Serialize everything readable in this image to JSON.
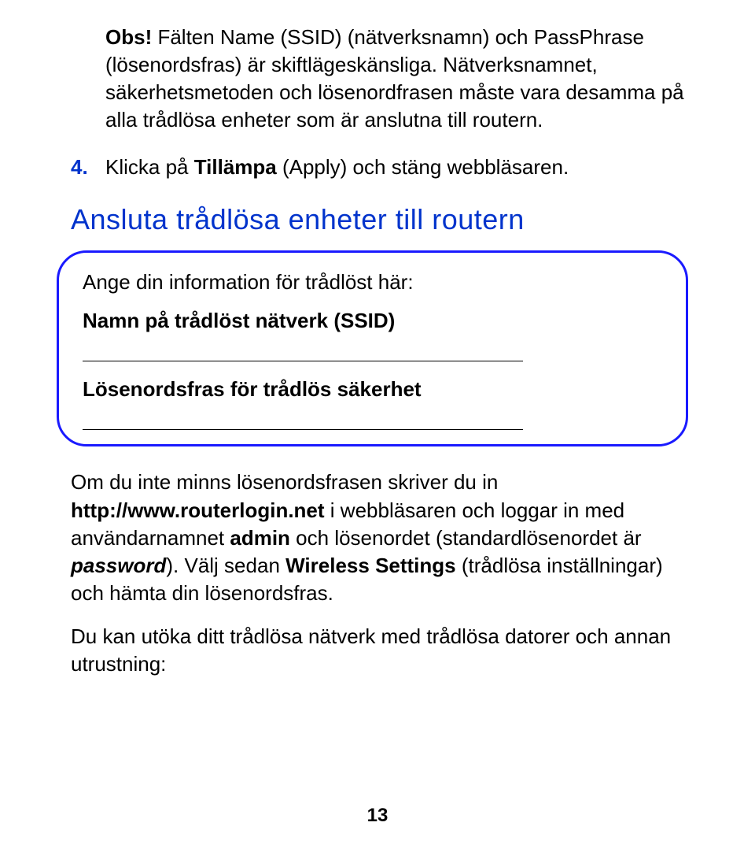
{
  "para1_obs": "Obs!",
  "para1_rest": " Fälten Name (SSID) (nätverksnamn) och PassPhrase (lösenordsfras) är skiftlägeskänsliga. Nätverksnamnet, säkerhetsmetoden och lösenordfrasen måste vara desamma på alla trådlösa enheter som är anslutna till routern.",
  "step4_num": "4.",
  "step4_pre": "Klicka på ",
  "step4_bold": "Tillämpa",
  "step4_post": " (Apply) och stäng webbläsaren.",
  "heading": "Ansluta trådlösa enheter till routern",
  "callout_intro": "Ange din information för trådlöst här:",
  "callout_label1": "Namn på trådlöst nätverk (SSID)",
  "callout_label2": "Lösenordsfras för trådlös säkerhet",
  "para2_a": "Om du inte minns lösenordsfrasen skriver du in ",
  "para2_url": "http://www.routerlogin.net",
  "para2_b": " i webbläsaren och loggar in med användarnamnet ",
  "para2_admin": "admin",
  "para2_c": " och lösenordet  (standardlösenordet är ",
  "para2_pwd": "password",
  "para2_d": "). Välj sedan ",
  "para2_ws": "Wireless Settings",
  "para2_e": " (trådlösa inställningar) och hämta din lösenordsfras.",
  "para3": "Du kan utöka ditt trådlösa nätverk med trådlösa datorer och annan utrustning:",
  "page_number": "13"
}
